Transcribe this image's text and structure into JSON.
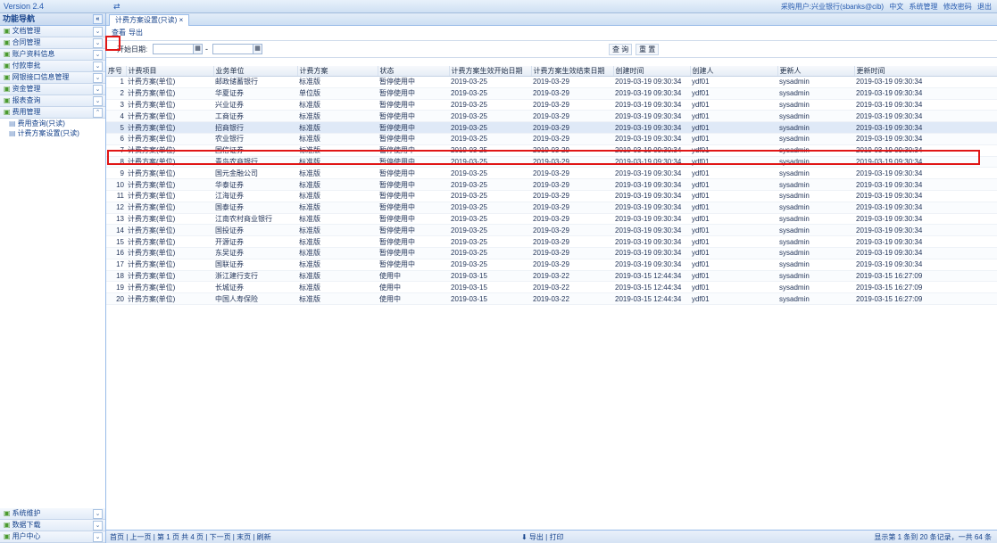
{
  "app": {
    "version": "Version 2.4",
    "top_icon": "⇄"
  },
  "top_links": [
    "采购用户:兴业银行(sbanks@cib)",
    "中文",
    "系统管理",
    "修改密码",
    "退出"
  ],
  "sidebar": {
    "title": "功能导航",
    "items": [
      {
        "label": "文档管理"
      },
      {
        "label": "合同管理"
      },
      {
        "label": "账户资料信息"
      },
      {
        "label": "付款审批"
      },
      {
        "label": "网银接口信息管理"
      },
      {
        "label": "资金管理"
      },
      {
        "label": "报表查询"
      },
      {
        "label": "费用管理"
      }
    ],
    "subitems": [
      {
        "label": "费用查询(只读)"
      },
      {
        "label": "计费方案设置(只读)"
      }
    ],
    "bottom_items": [
      {
        "label": "系统维护"
      },
      {
        "label": "数据下载"
      },
      {
        "label": "用户中心"
      }
    ]
  },
  "tab": {
    "label": "计费方案设置(只读)"
  },
  "toolbar": {
    "view_label": "查看",
    "export_label": "导出"
  },
  "search": {
    "label": "开始日期:",
    "from_value": "",
    "to_value": "",
    "sep": "-",
    "query_label": "查 询",
    "reset_label": "重 置"
  },
  "grid": {
    "columns": [
      "序号",
      "计费项目",
      "业务单位",
      "计费方案",
      "状态",
      "计费方案生效开始日期",
      "计费方案生效结束日期",
      "创建时间",
      "创建人",
      "更新人",
      "更新时间"
    ],
    "rows": [
      {
        "no": "1",
        "item": "计费方案(单位)",
        "unit": "邮政储蓄银行",
        "plan": "标准版",
        "status": "暂停使用中",
        "start": "2019-03-25",
        "end": "2019-03-29",
        "created": "2019-03-19 09:30:34",
        "creator": "ydf01",
        "updater": "sysadmin",
        "updated": "2019-03-19 09:30:34"
      },
      {
        "no": "2",
        "item": "计费方案(单位)",
        "unit": "华夏证券",
        "plan": "单位版",
        "status": "暂停使用中",
        "start": "2019-03-25",
        "end": "2019-03-29",
        "created": "2019-03-19 09:30:34",
        "creator": "ydf01",
        "updater": "sysadmin",
        "updated": "2019-03-19 09:30:34"
      },
      {
        "no": "3",
        "item": "计费方案(单位)",
        "unit": "兴业证券",
        "plan": "标准版",
        "status": "暂停使用中",
        "start": "2019-03-25",
        "end": "2019-03-29",
        "created": "2019-03-19 09:30:34",
        "creator": "ydf01",
        "updater": "sysadmin",
        "updated": "2019-03-19 09:30:34"
      },
      {
        "no": "4",
        "item": "计费方案(单位)",
        "unit": "工商证券",
        "plan": "标准版",
        "status": "暂停使用中",
        "start": "2019-03-25",
        "end": "2019-03-29",
        "created": "2019-03-19 09:30:34",
        "creator": "ydf01",
        "updater": "sysadmin",
        "updated": "2019-03-19 09:30:34"
      },
      {
        "no": "5",
        "item": "计费方案(单位)",
        "unit": "招商银行",
        "plan": "标准版",
        "status": "暂停使用中",
        "start": "2019-03-25",
        "end": "2019-03-29",
        "created": "2019-03-19 09:30:34",
        "creator": "ydf01",
        "updater": "sysadmin",
        "updated": "2019-03-19 09:30:34"
      },
      {
        "no": "6",
        "item": "计费方案(单位)",
        "unit": "农业银行",
        "plan": "标准版",
        "status": "暂停使用中",
        "start": "2019-03-25",
        "end": "2019-03-29",
        "created": "2019-03-19 09:30:34",
        "creator": "ydf01",
        "updater": "sysadmin",
        "updated": "2019-03-19 09:30:34"
      },
      {
        "no": "7",
        "item": "计费方案(单位)",
        "unit": "国信证券",
        "plan": "标准版",
        "status": "暂停使用中",
        "start": "2019-03-25",
        "end": "2019-03-29",
        "created": "2019-03-19 09:30:34",
        "creator": "ydf01",
        "updater": "sysadmin",
        "updated": "2019-03-19 09:30:34"
      },
      {
        "no": "8",
        "item": "计费方案(单位)",
        "unit": "青岛农商银行",
        "plan": "标准版",
        "status": "暂停使用中",
        "start": "2019-03-25",
        "end": "2019-03-29",
        "created": "2019-03-19 09:30:34",
        "creator": "ydf01",
        "updater": "sysadmin",
        "updated": "2019-03-19 09:30:34"
      },
      {
        "no": "9",
        "item": "计费方案(单位)",
        "unit": "国元金融公司",
        "plan": "标准版",
        "status": "暂停使用中",
        "start": "2019-03-25",
        "end": "2019-03-29",
        "created": "2019-03-19 09:30:34",
        "creator": "ydf01",
        "updater": "sysadmin",
        "updated": "2019-03-19 09:30:34"
      },
      {
        "no": "10",
        "item": "计费方案(单位)",
        "unit": "华泰证券",
        "plan": "标准版",
        "status": "暂停使用中",
        "start": "2019-03-25",
        "end": "2019-03-29",
        "created": "2019-03-19 09:30:34",
        "creator": "ydf01",
        "updater": "sysadmin",
        "updated": "2019-03-19 09:30:34"
      },
      {
        "no": "11",
        "item": "计费方案(单位)",
        "unit": "江海证券",
        "plan": "标准版",
        "status": "暂停使用中",
        "start": "2019-03-25",
        "end": "2019-03-29",
        "created": "2019-03-19 09:30:34",
        "creator": "ydf01",
        "updater": "sysadmin",
        "updated": "2019-03-19 09:30:34"
      },
      {
        "no": "12",
        "item": "计费方案(单位)",
        "unit": "国泰证券",
        "plan": "标准版",
        "status": "暂停使用中",
        "start": "2019-03-25",
        "end": "2019-03-29",
        "created": "2019-03-19 09:30:34",
        "creator": "ydf01",
        "updater": "sysadmin",
        "updated": "2019-03-19 09:30:34"
      },
      {
        "no": "13",
        "item": "计费方案(单位)",
        "unit": "江南农村商业银行",
        "plan": "标准版",
        "status": "暂停使用中",
        "start": "2019-03-25",
        "end": "2019-03-29",
        "created": "2019-03-19 09:30:34",
        "creator": "ydf01",
        "updater": "sysadmin",
        "updated": "2019-03-19 09:30:34"
      },
      {
        "no": "14",
        "item": "计费方案(单位)",
        "unit": "国投证券",
        "plan": "标准版",
        "status": "暂停使用中",
        "start": "2019-03-25",
        "end": "2019-03-29",
        "created": "2019-03-19 09:30:34",
        "creator": "ydf01",
        "updater": "sysadmin",
        "updated": "2019-03-19 09:30:34"
      },
      {
        "no": "15",
        "item": "计费方案(单位)",
        "unit": "开源证券",
        "plan": "标准版",
        "status": "暂停使用中",
        "start": "2019-03-25",
        "end": "2019-03-29",
        "created": "2019-03-19 09:30:34",
        "creator": "ydf01",
        "updater": "sysadmin",
        "updated": "2019-03-19 09:30:34"
      },
      {
        "no": "16",
        "item": "计费方案(单位)",
        "unit": "东吴证券",
        "plan": "标准版",
        "status": "暂停使用中",
        "start": "2019-03-25",
        "end": "2019-03-29",
        "created": "2019-03-19 09:30:34",
        "creator": "ydf01",
        "updater": "sysadmin",
        "updated": "2019-03-19 09:30:34"
      },
      {
        "no": "17",
        "item": "计费方案(单位)",
        "unit": "国联证券",
        "plan": "标准版",
        "status": "暂停使用中",
        "start": "2019-03-25",
        "end": "2019-03-29",
        "created": "2019-03-19 09:30:34",
        "creator": "ydf01",
        "updater": "sysadmin",
        "updated": "2019-03-19 09:30:34"
      },
      {
        "no": "18",
        "item": "计费方案(单位)",
        "unit": "浙江建行支行",
        "plan": "标准版",
        "status": "使用中",
        "start": "2019-03-15",
        "end": "2019-03-22",
        "created": "2019-03-15 12:44:34",
        "creator": "ydf01",
        "updater": "sysadmin",
        "updated": "2019-03-15 16:27:09"
      },
      {
        "no": "19",
        "item": "计费方案(单位)",
        "unit": "长城证券",
        "plan": "标准版",
        "status": "使用中",
        "start": "2019-03-15",
        "end": "2019-03-22",
        "created": "2019-03-15 12:44:34",
        "creator": "ydf01",
        "updater": "sysadmin",
        "updated": "2019-03-15 16:27:09"
      },
      {
        "no": "20",
        "item": "计费方案(单位)",
        "unit": "中国人寿保险",
        "plan": "标准版",
        "status": "使用中",
        "start": "2019-03-15",
        "end": "2019-03-22",
        "created": "2019-03-15 12:44:34",
        "creator": "ydf01",
        "updater": "sysadmin",
        "updated": "2019-03-15 16:27:09"
      }
    ]
  },
  "pager": {
    "left": "首页 | 上一页 | 第 1 页 共 4 页 | 下一页 | 末页 | 刷新",
    "center": "⬇ 导出 | 打印",
    "right": "显示第 1 条到 20 条记录，一共 64 条"
  },
  "colors": {
    "accent": "#15428b",
    "highlight_box": "#e01616",
    "selected_row": "#dfe9f7"
  }
}
